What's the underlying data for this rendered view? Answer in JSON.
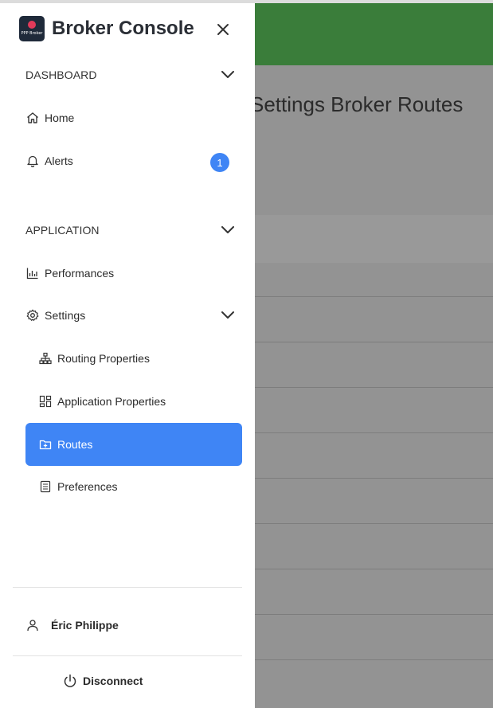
{
  "brand": {
    "logo_text": "PPP Broker",
    "title": "Broker Console"
  },
  "background": {
    "page_title": "Settings Broker Routes"
  },
  "sections": {
    "dashboard": "DASHBOARD",
    "application": "APPLICATION"
  },
  "menu": {
    "home": "Home",
    "alerts": "Alerts",
    "alerts_count": "1",
    "performances": "Performances",
    "settings": "Settings",
    "routing_properties": "Routing Properties",
    "application_properties": "Application Properties",
    "routes": "Routes",
    "preferences": "Preferences"
  },
  "user": {
    "name": "Éric Philippe"
  },
  "actions": {
    "disconnect": "Disconnect"
  },
  "colors": {
    "accent": "#3f85f5",
    "appbar": "#3a7d3a",
    "overlay": "#939393"
  }
}
